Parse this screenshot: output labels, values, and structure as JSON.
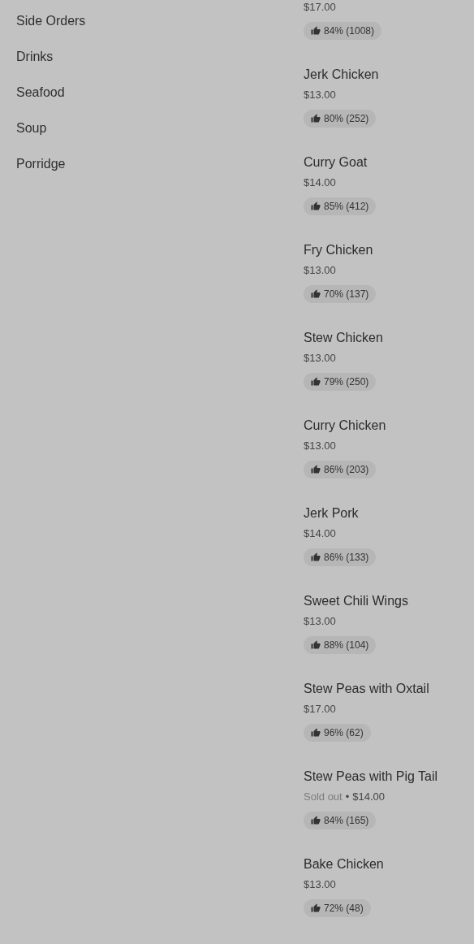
{
  "categories": [
    {
      "label": "Side Orders"
    },
    {
      "label": "Drinks"
    },
    {
      "label": "Seafood"
    },
    {
      "label": "Soup"
    },
    {
      "label": "Porridge"
    }
  ],
  "items": [
    {
      "price": "$17.00",
      "rating": "84% (1008)"
    },
    {
      "name": "Jerk Chicken",
      "price": "$13.00",
      "rating": "80% (252)"
    },
    {
      "name": "Curry Goat",
      "price": "$14.00",
      "rating": "85% (412)"
    },
    {
      "name": "Fry Chicken",
      "price": "$13.00",
      "rating": "70% (137)"
    },
    {
      "name": "Stew Chicken",
      "price": "$13.00",
      "rating": "79% (250)"
    },
    {
      "name": "Curry Chicken",
      "price": "$13.00",
      "rating": "86% (203)"
    },
    {
      "name": "Jerk Pork",
      "price": "$14.00",
      "rating": "86% (133)"
    },
    {
      "name": "Sweet Chili Wings",
      "price": "$13.00",
      "rating": "88% (104)"
    },
    {
      "name": "Stew Peas with Oxtail",
      "price": "$17.00",
      "rating": "96% (62)"
    },
    {
      "name": "Stew Peas with Pig Tail",
      "availability": "Sold out",
      "separator": "•",
      "price": "$14.00",
      "rating": "84% (165)"
    },
    {
      "name": "Bake Chicken",
      "price": "$13.00",
      "rating": "72% (48)"
    }
  ]
}
